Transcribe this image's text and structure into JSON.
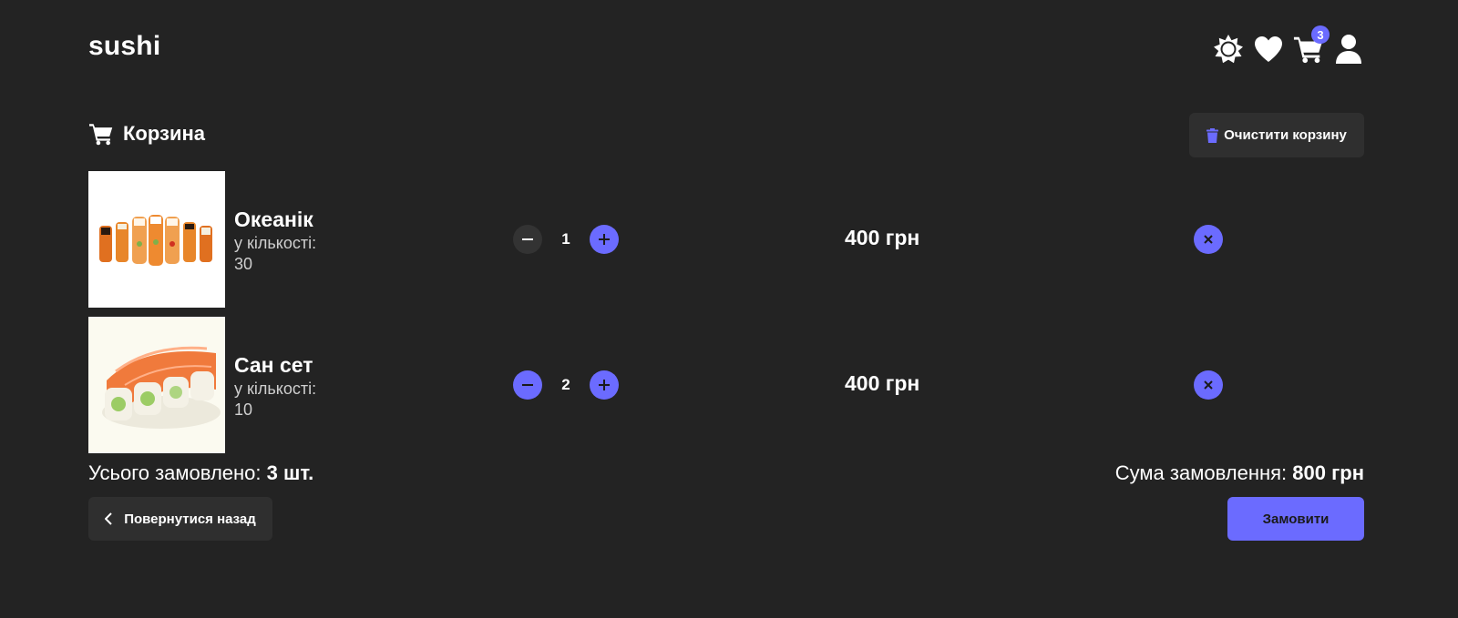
{
  "header": {
    "logo": "sushi",
    "icons": [
      "sun-icon",
      "heart-icon",
      "cart-icon",
      "user-icon"
    ],
    "cart_count": "3"
  },
  "cart": {
    "title": "Корзина",
    "clear_label": "Очистити корзину",
    "items": [
      {
        "name": "Океанік",
        "qty_label": "у кількості:",
        "pieces": "30",
        "count": "1",
        "price": "400 грн"
      },
      {
        "name": "Сан сет",
        "qty_label": "у кількості:",
        "pieces": "10",
        "count": "2",
        "price": "400 грн"
      }
    ]
  },
  "summary": {
    "total_label": "Усього замовлено:",
    "total_value": "3 шт.",
    "sum_label": "Сума замовлення:",
    "sum_value": "800 грн"
  },
  "actions": {
    "back_label": "Повернутися назад",
    "order_label": "Замовити"
  },
  "colors": {
    "background": "#232323",
    "accent": "#6b6bff",
    "button_dark": "#2f2f2f"
  }
}
